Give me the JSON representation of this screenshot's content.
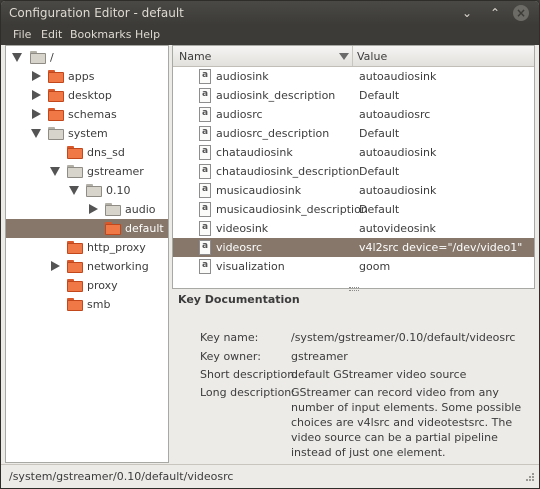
{
  "window": {
    "title": "Configuration Editor - default"
  },
  "window_controls": {
    "minimize": "⌄",
    "maximize": "⌃",
    "close": "×"
  },
  "menu": {
    "file": "File",
    "edit": "Edit",
    "bookmarks": "Bookmarks",
    "help": "Help"
  },
  "tree": {
    "root": "/",
    "apps": "apps",
    "desktop": "desktop",
    "schemas": "schemas",
    "system": "system",
    "dns_sd": "dns_sd",
    "gstreamer": "gstreamer",
    "v010": "0.10",
    "audio": "audio",
    "default": "default",
    "http_proxy": "http_proxy",
    "networking": "networking",
    "proxy": "proxy",
    "smb": "smb"
  },
  "table": {
    "col_name": "Name",
    "col_value": "Value",
    "rows": [
      {
        "name": "audiosink",
        "value": "autoaudiosink"
      },
      {
        "name": "audiosink_description",
        "value": "Default"
      },
      {
        "name": "audiosrc",
        "value": "autoaudiosrc"
      },
      {
        "name": "audiosrc_description",
        "value": "Default"
      },
      {
        "name": "chataudiosink",
        "value": "autoaudiosink"
      },
      {
        "name": "chataudiosink_description",
        "value": "Default"
      },
      {
        "name": "musicaudiosink",
        "value": "autoaudiosink"
      },
      {
        "name": "musicaudiosink_description",
        "value": "Default"
      },
      {
        "name": "videosink",
        "value": "autovideosink"
      },
      {
        "name": "videosrc",
        "value": "v4l2src device=\"/dev/video1\""
      },
      {
        "name": "visualization",
        "value": "goom"
      }
    ],
    "icon_letter": "a"
  },
  "docs": {
    "heading": "Key Documentation",
    "key_name_label": "Key name:",
    "key_name": "/system/gstreamer/0.10/default/videosrc",
    "key_owner_label": "Key owner:",
    "key_owner": "gstreamer",
    "short_label": "Short description:",
    "short": "default GStreamer video source",
    "long_label": "Long description:",
    "long": "GStreamer can record video from any number of input elements. Some possible choices are v4lsrc and videotestsrc. The video source can be a partial pipeline instead of just one element."
  },
  "status": {
    "path": "/system/gstreamer/0.10/default/videosrc"
  },
  "colors": {
    "selection": "#86776a",
    "folder_orange": "#f07746",
    "titlebar": "#3c3b37"
  }
}
